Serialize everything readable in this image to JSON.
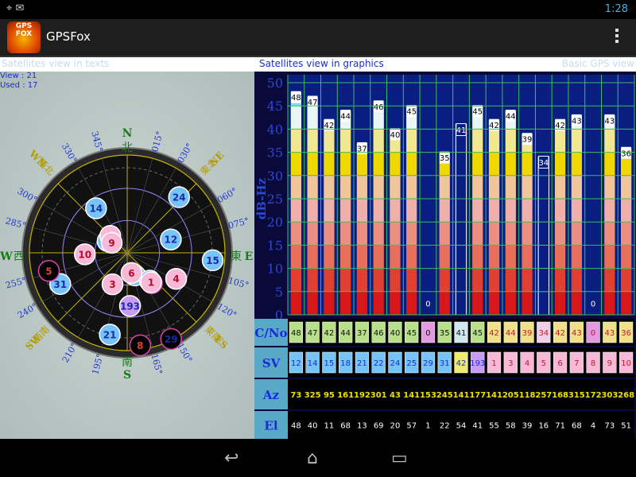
{
  "status": {
    "time": "1:28"
  },
  "app": {
    "title": "GPSFox",
    "logo_text": "GPS FOX"
  },
  "tabs": {
    "texts": "Satellites view in texts",
    "graphics": "Satellites view in graphics",
    "basic": "Basic GPS view"
  },
  "info": {
    "view": "View : 21",
    "used": "Used : 17"
  },
  "compass": {
    "N": "N",
    "N_kanji": "北",
    "S": "S",
    "S_kanji": "南",
    "E": "E",
    "E_kanji": "東",
    "W": "W",
    "W_kanji": "西",
    "NE": "NE",
    "NE_kanji": "東北",
    "NW": "WN",
    "NW_kanji": "西北",
    "SE": "ES",
    "SE_kanji": "東南",
    "SW": "SW",
    "SW_kanji": "西南",
    "degrees": [
      "015°",
      "030°",
      "060°",
      "075°",
      "105°",
      "120°",
      "150°",
      "165°",
      "195°",
      "210°",
      "240°",
      "255°",
      "285°",
      "300°",
      "330°",
      "345°"
    ]
  },
  "row_labels": {
    "cno": "C/No",
    "sv": "SV",
    "az": "Az",
    "el": "El"
  },
  "colors": {
    "gps_fill": "#76c3f7",
    "glonass_fill": "#f8b8d8",
    "sbas_fill": "#c99cf5",
    "chart_bg": "#0a1d80",
    "grid": "#3bbf5a"
  },
  "satellites": [
    {
      "sv": "12",
      "cno": "48",
      "az": "73",
      "el": "48",
      "type": "gps",
      "used": true
    },
    {
      "sv": "14",
      "cno": "47",
      "az": "325",
      "el": "40",
      "type": "gps",
      "used": true
    },
    {
      "sv": "15",
      "cno": "42",
      "az": "95",
      "el": "11",
      "type": "gps",
      "used": true
    },
    {
      "sv": "18",
      "cno": "44",
      "az": "161",
      "el": "68",
      "type": "gps",
      "used": true
    },
    {
      "sv": "21",
      "cno": "37",
      "az": "192",
      "el": "13",
      "type": "gps",
      "used": true
    },
    {
      "sv": "22",
      "cno": "46",
      "az": "301",
      "el": "69",
      "type": "gps",
      "used": true
    },
    {
      "sv": "24",
      "cno": "40",
      "az": "43",
      "el": "20",
      "type": "gps",
      "used": true
    },
    {
      "sv": "25",
      "cno": "45",
      "az": "141",
      "el": "57",
      "type": "gps",
      "used": true
    },
    {
      "sv": "29",
      "cno": "0",
      "az": "153",
      "el": "1",
      "type": "gps",
      "used": false
    },
    {
      "sv": "31",
      "cno": "35",
      "az": "245",
      "el": "22",
      "type": "gps",
      "used": true
    },
    {
      "sv": "42",
      "cno": "41",
      "az": "141",
      "el": "54",
      "type": "sbas",
      "used": false
    },
    {
      "sv": "193",
      "cno": "45",
      "az": "177",
      "el": "41",
      "type": "sbas",
      "used": true
    },
    {
      "sv": "1",
      "cno": "42",
      "az": "141",
      "el": "55",
      "type": "glonass",
      "used": true
    },
    {
      "sv": "3",
      "cno": "44",
      "az": "205",
      "el": "58",
      "type": "glonass",
      "used": true
    },
    {
      "sv": "4",
      "cno": "39",
      "az": "118",
      "el": "39",
      "type": "glonass",
      "used": true
    },
    {
      "sv": "5",
      "cno": "34",
      "az": "257",
      "el": "16",
      "type": "glonass",
      "used": false
    },
    {
      "sv": "6",
      "cno": "42",
      "az": "168",
      "el": "71",
      "type": "glonass",
      "used": true
    },
    {
      "sv": "7",
      "cno": "43",
      "az": "315",
      "el": "68",
      "type": "glonass",
      "used": true
    },
    {
      "sv": "8",
      "cno": "0",
      "az": "172",
      "el": "4",
      "type": "glonass",
      "used": false
    },
    {
      "sv": "9",
      "cno": "43",
      "az": "303",
      "el": "73",
      "type": "glonass",
      "used": true
    },
    {
      "sv": "10",
      "cno": "36",
      "az": "268",
      "el": "51",
      "type": "glonass",
      "used": true
    }
  ],
  "chart_data": {
    "type": "bar",
    "ylabel": "dB-Hz",
    "ylim": [
      0,
      50
    ],
    "yticks": [
      "0",
      "5",
      "10",
      "15",
      "20",
      "25",
      "30",
      "35",
      "40",
      "45",
      "50"
    ],
    "categories": [
      "12",
      "14",
      "15",
      "18",
      "21",
      "22",
      "24",
      "25",
      "29",
      "31",
      "42",
      "193",
      "1",
      "3",
      "4",
      "5",
      "6",
      "7",
      "8",
      "9",
      "10"
    ],
    "values": [
      48,
      47,
      42,
      44,
      37,
      46,
      40,
      45,
      0,
      35,
      41,
      45,
      42,
      44,
      39,
      34,
      42,
      43,
      0,
      43,
      36
    ]
  }
}
